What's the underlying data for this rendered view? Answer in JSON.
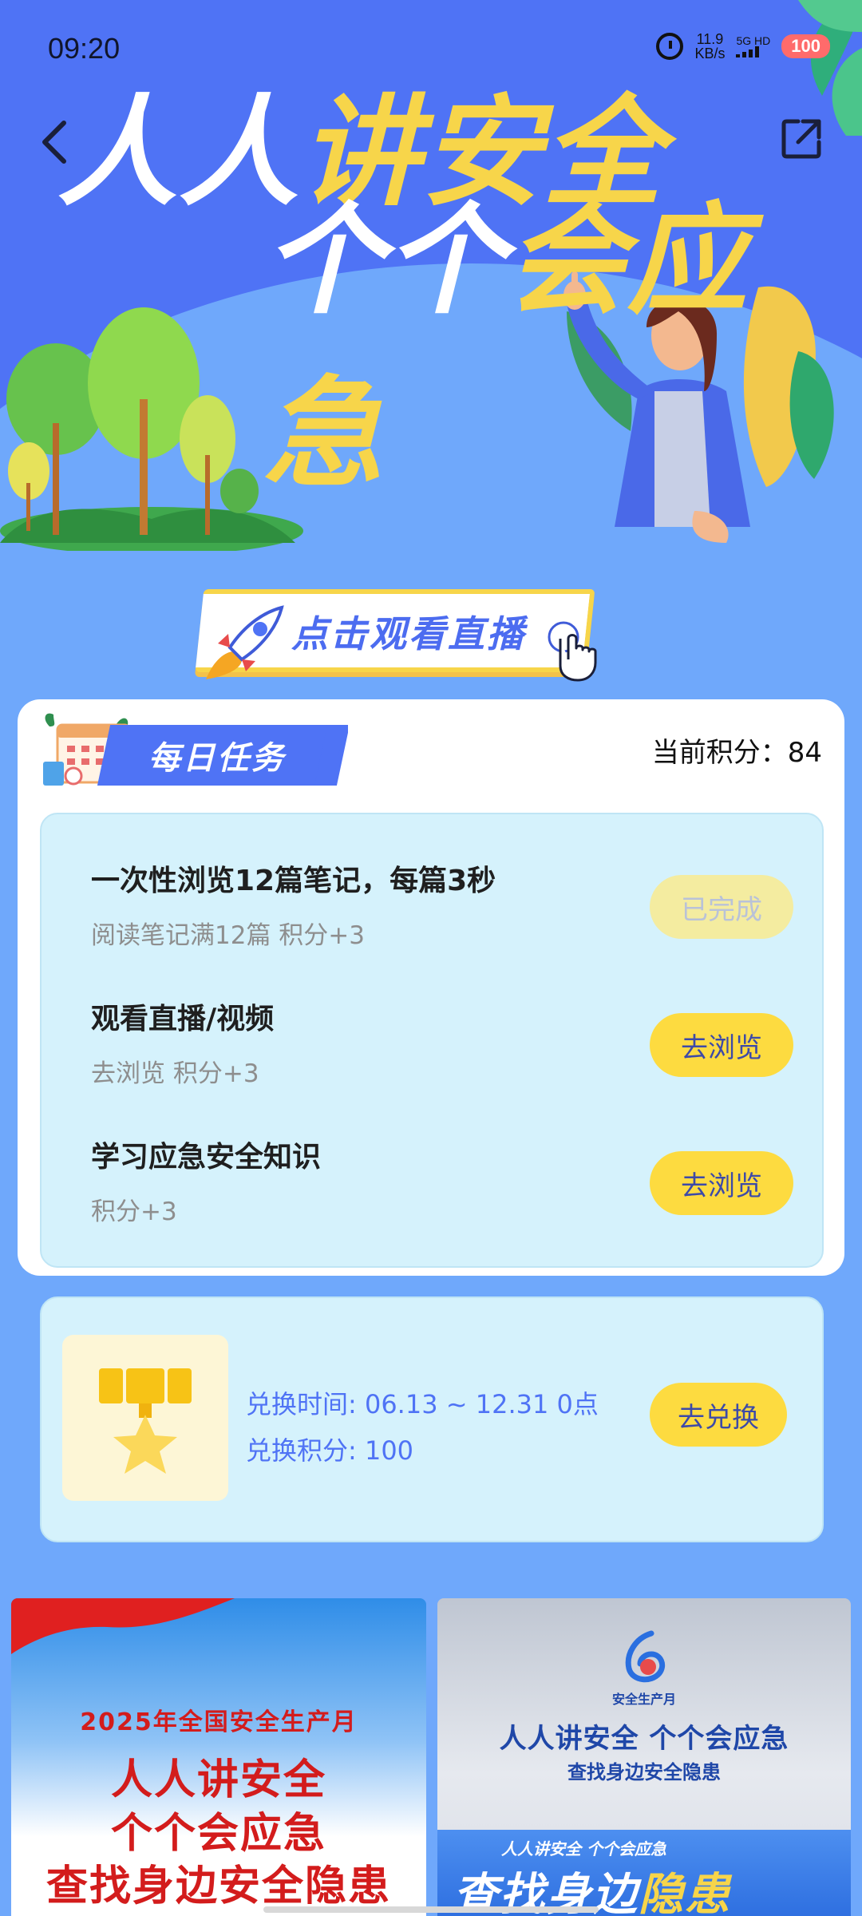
{
  "status_bar": {
    "time": "09:20",
    "net_speed_value": "11.9",
    "net_speed_unit": "KB/s",
    "signal_label": "5G HD",
    "battery": "100"
  },
  "hero": {
    "title_line1_white": "人人",
    "title_line1_yellow": "讲安全",
    "title_line2_white": "个个",
    "title_line2_yellow": "会应急",
    "live_button": "点击观看直播"
  },
  "daily_tasks": {
    "header": "每日任务",
    "points_label": "当前积分：",
    "points_value": "84",
    "tasks": [
      {
        "title": "一次性浏览12篇笔记，每篇3秒",
        "subtitle": "阅读笔记满12篇 积分+3",
        "button": "已完成",
        "completed": true
      },
      {
        "title": "观看直播/视频",
        "subtitle": "去浏览 积分+3",
        "button": "去浏览",
        "completed": false
      },
      {
        "title": "学习应急安全知识",
        "subtitle": "积分+3",
        "button": "去浏览",
        "completed": false
      }
    ]
  },
  "exchange": {
    "time_text": "兑换时间: 06.13 ~ 12.31 0点",
    "points_text": "兑换积分: 100",
    "button": "去兑换",
    "icon": "medal-icon"
  },
  "thumbnails": {
    "left": {
      "year_line": "2025年全国安全生产月",
      "line1": "人人讲安全",
      "line2": "个个会应急",
      "line3": "查找身边安全隐患"
    },
    "right": {
      "logo_text": "安全生产月",
      "main": "人人讲安全  个个会应急",
      "sub": "查找身边安全隐患",
      "band_small": "人人讲安全  个个会应急",
      "band_big_a": "查找身边",
      "band_big_b": "隐患"
    }
  },
  "colors": {
    "brand_blue": "#4f73f5",
    "accent_yellow": "#fddb40",
    "card_bg": "#d5f2fc"
  }
}
